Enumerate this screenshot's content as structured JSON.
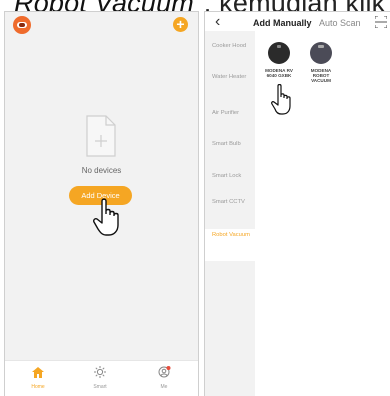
{
  "caption": {
    "italic_part": "Robot Vacuum\"",
    "rest": ", kemudian klik"
  },
  "home_screen": {
    "empty_text": "No devices",
    "add_button_label": "Add Device",
    "tabs": [
      {
        "label": "Home",
        "icon": "home-icon",
        "active": true
      },
      {
        "label": "Smart",
        "icon": "sun-icon",
        "active": false
      },
      {
        "label": "Me",
        "icon": "profile-icon",
        "active": false
      }
    ],
    "accent_color": "#f5a623",
    "brand_color": "#ef6b2c"
  },
  "add_screen": {
    "tabs": {
      "manual": "Add Manually",
      "auto": "Auto Scan"
    },
    "categories": [
      {
        "label": "Cooker Hood",
        "selected": false
      },
      {
        "label": "Water Heater",
        "selected": false
      },
      {
        "label": "Air Purifier",
        "selected": false
      },
      {
        "label": "Smart Bulb",
        "selected": false
      },
      {
        "label": "Smart Lock",
        "selected": false
      },
      {
        "label": "Smart CCTV",
        "selected": false
      },
      {
        "label": "Robot Vacuum",
        "selected": true
      }
    ],
    "products": [
      {
        "label": "MODENA RV 6040 GXBK"
      },
      {
        "label": "MODENA ROBOT VACUUM"
      }
    ]
  }
}
